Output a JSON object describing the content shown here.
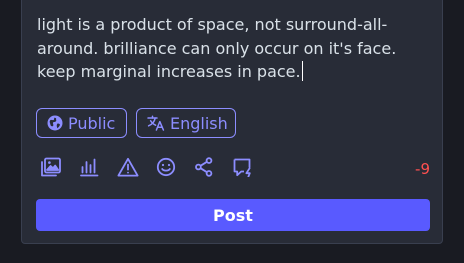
{
  "compose": {
    "text": "light is a product of space, not surround-all-around. brilliance can only occur on it's face. keep marginal increases in pace."
  },
  "visibility": {
    "label": "Public",
    "icon": "globe-icon"
  },
  "language": {
    "label": "English",
    "icon": "translate-icon"
  },
  "toolbar": {
    "icons": [
      "image-icon",
      "poll-icon",
      "warning-icon",
      "emoji-icon",
      "share-icon",
      "quote-icon"
    ]
  },
  "character_counter": "-9",
  "post_button_label": "Post",
  "colors": {
    "accent": "#8c8dff",
    "button": "#595aff",
    "counter_over_limit": "#ff5050",
    "card": "#282c37",
    "background": "#191b22"
  }
}
